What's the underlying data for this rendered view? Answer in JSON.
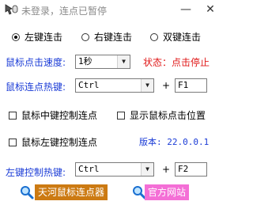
{
  "window": {
    "title": "未登录，连点已暂停",
    "minimize": "—",
    "close": "✕"
  },
  "click_mode": {
    "options": [
      "左键连击",
      "右键连击",
      "双键连击"
    ],
    "selected_index": 0
  },
  "speed": {
    "label": "鼠标点击速度:",
    "value": "1秒"
  },
  "status": {
    "text": "状态：点击停止",
    "color": "#e01818"
  },
  "hotkey": {
    "label": "鼠标连点热键:",
    "modifier": "Ctrl",
    "plus": "+",
    "key": "F1"
  },
  "options": {
    "middle_click_control": "鼠标中键控制连点",
    "show_click_position": "显示鼠标点击位置",
    "left_click_control": "鼠标左键控制连点"
  },
  "version": "版本: 22.0.0.1",
  "left_hotkey": {
    "label": "左键控制热键:",
    "modifier": "Ctrl",
    "plus": "+",
    "key": "F2"
  },
  "buttons": {
    "app_name": "天河鼠标连点器",
    "official_site": "官方网站"
  },
  "colors": {
    "label_blue": "#1a3bd6",
    "orange_button": "#cc7a12",
    "pink_button": "#f46fd6"
  }
}
